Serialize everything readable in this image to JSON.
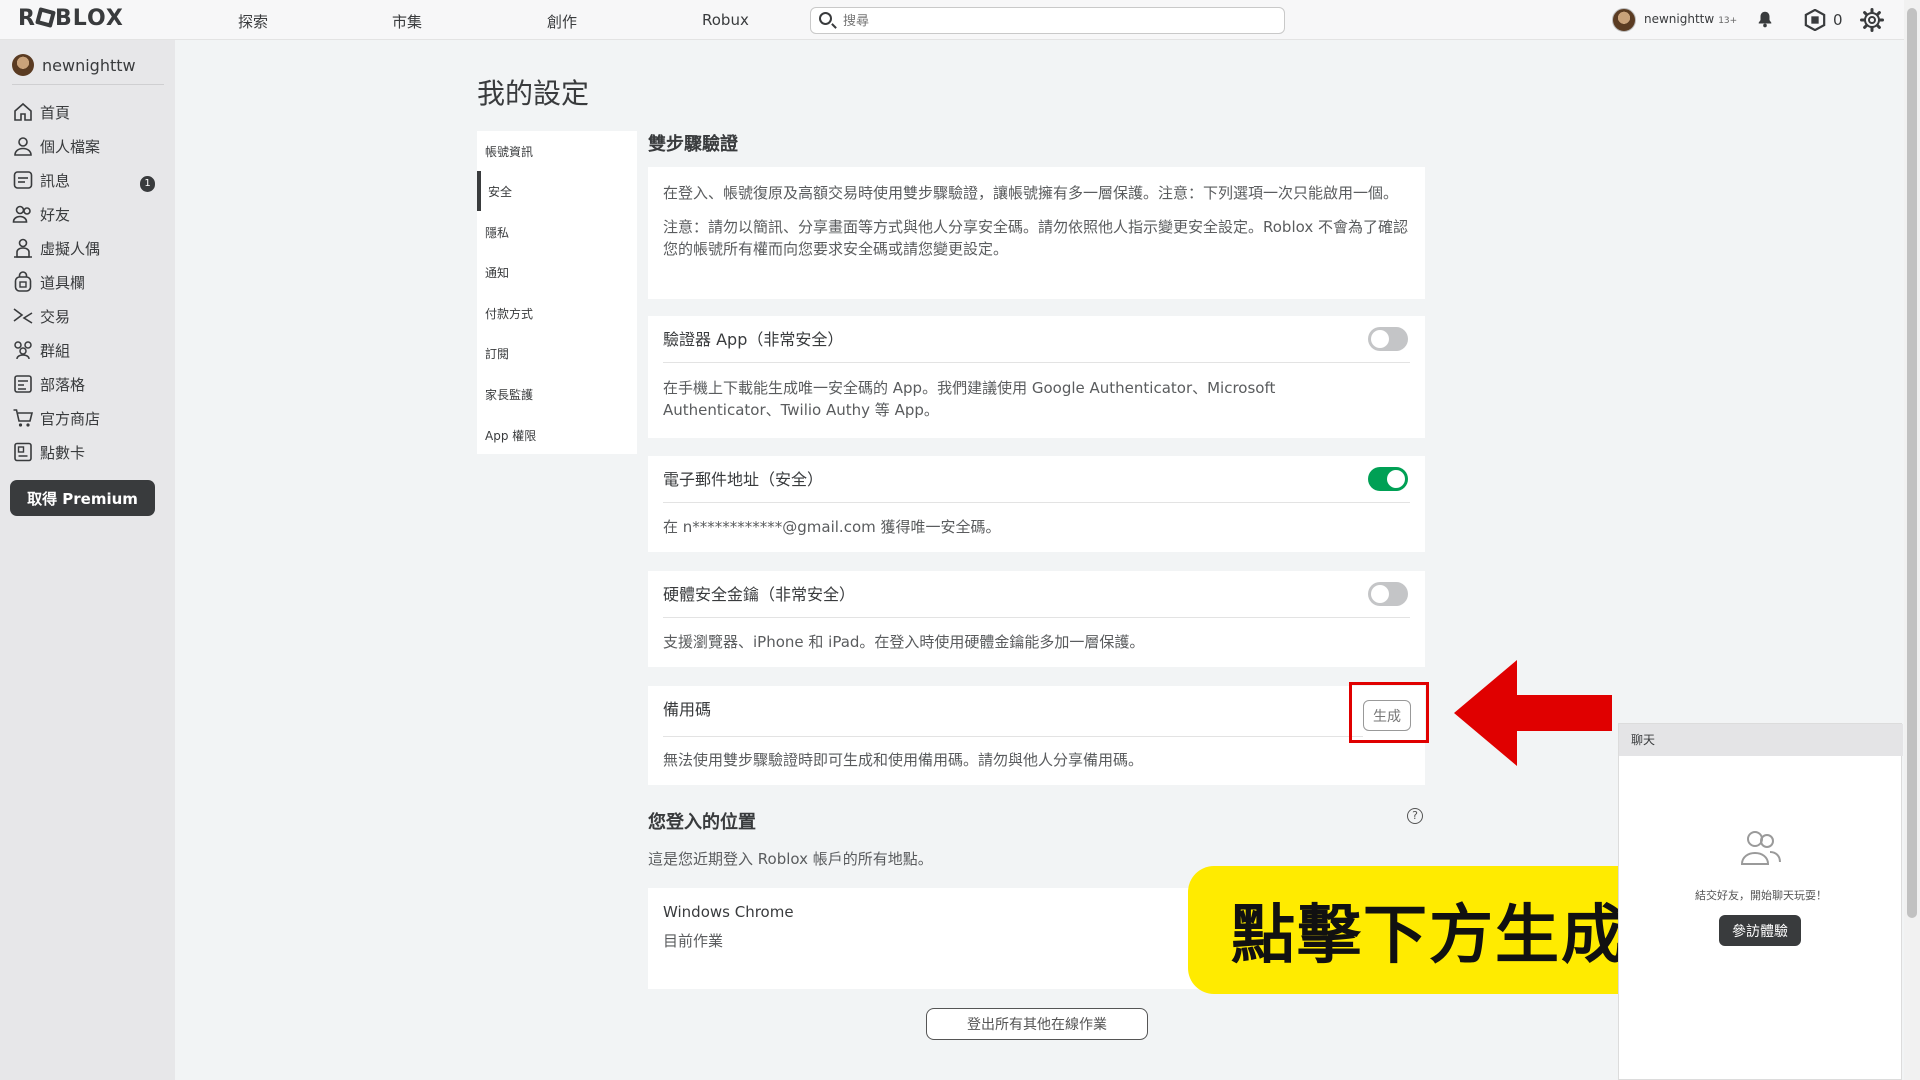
{
  "topbar": {
    "logo": "ROBLOX",
    "nav": [
      "探索",
      "市集",
      "創作",
      "Robux"
    ],
    "search_placeholder": "搜尋",
    "username": "newnighttw",
    "age_tag": "13+",
    "robux_count": "0"
  },
  "sidebar": {
    "username": "newnighttw",
    "items": [
      {
        "label": "首頁",
        "icon": "home-icon"
      },
      {
        "label": "個人檔案",
        "icon": "profile-icon"
      },
      {
        "label": "訊息",
        "icon": "messages-icon",
        "badge": "1"
      },
      {
        "label": "好友",
        "icon": "friends-icon"
      },
      {
        "label": "虛擬人偶",
        "icon": "avatar-icon"
      },
      {
        "label": "道具欄",
        "icon": "inventory-icon"
      },
      {
        "label": "交易",
        "icon": "trade-icon"
      },
      {
        "label": "群組",
        "icon": "groups-icon"
      },
      {
        "label": "部落格",
        "icon": "blog-icon"
      },
      {
        "label": "官方商店",
        "icon": "store-icon"
      },
      {
        "label": "點數卡",
        "icon": "giftcard-icon"
      }
    ],
    "premium_label": "取得 Premium"
  },
  "main": {
    "title": "我的設定",
    "tabs": [
      "帳號資訊",
      "安全",
      "隱私",
      "通知",
      "付款方式",
      "訂閱",
      "家長監護",
      "App 權限"
    ],
    "active_tab": "安全",
    "two_step": {
      "title": "雙步驟驗證",
      "intro1": "在登入、帳號復原及高額交易時使用雙步驟驗證，讓帳號擁有多一層保護。注意：下列選項一次只能啟用一個。",
      "intro2": "注意：請勿以簡訊、分享畫面等方式與他人分享安全碼。請勿依照他人指示變更安全設定。Roblox 不會為了確認您的帳號所有權而向您要求安全碼或請您變更設定。",
      "authenticator": {
        "title": "驗證器 App（非常安全）",
        "desc": "在手機上下載能生成唯一安全碼的 App。我們建議使用 Google Authenticator、Microsoft Authenticator、Twilio Authy 等 App。",
        "enabled": false
      },
      "email": {
        "title": "電子郵件地址（安全）",
        "desc": "在 n************@gmail.com 獲得唯一安全碼。",
        "enabled": true
      },
      "security_key": {
        "title": "硬體安全金鑰（非常安全）",
        "desc": "支援瀏覽器、iPhone 和 iPad。在登入時使用硬體金鑰能多加一層保護。",
        "enabled": false
      },
      "backup_codes": {
        "title": "備用碼",
        "button": "生成",
        "desc": "無法使用雙步驟驗證時即可生成和使用備用碼。請勿與他人分享備用碼。"
      }
    },
    "login_locations": {
      "title": "您登入的位置",
      "subtitle": "這是您近期登入 Roblox 帳戶的所有地點。",
      "session_name": "Windows Chrome",
      "session_status": "目前作業",
      "logout_button": "登出所有其他在線作業"
    }
  },
  "annotation": {
    "callout": "點擊下方生成",
    "color_arrow": "#e00000",
    "color_callout": "#ffeb00"
  },
  "chat": {
    "title": "聊天",
    "message": "結交好友，開始聊天玩耍！",
    "button": "參訪體驗"
  },
  "colors": {
    "toggle_on": "#00a055",
    "toggle_off": "#c4c5c7",
    "dark": "#393b3d"
  }
}
